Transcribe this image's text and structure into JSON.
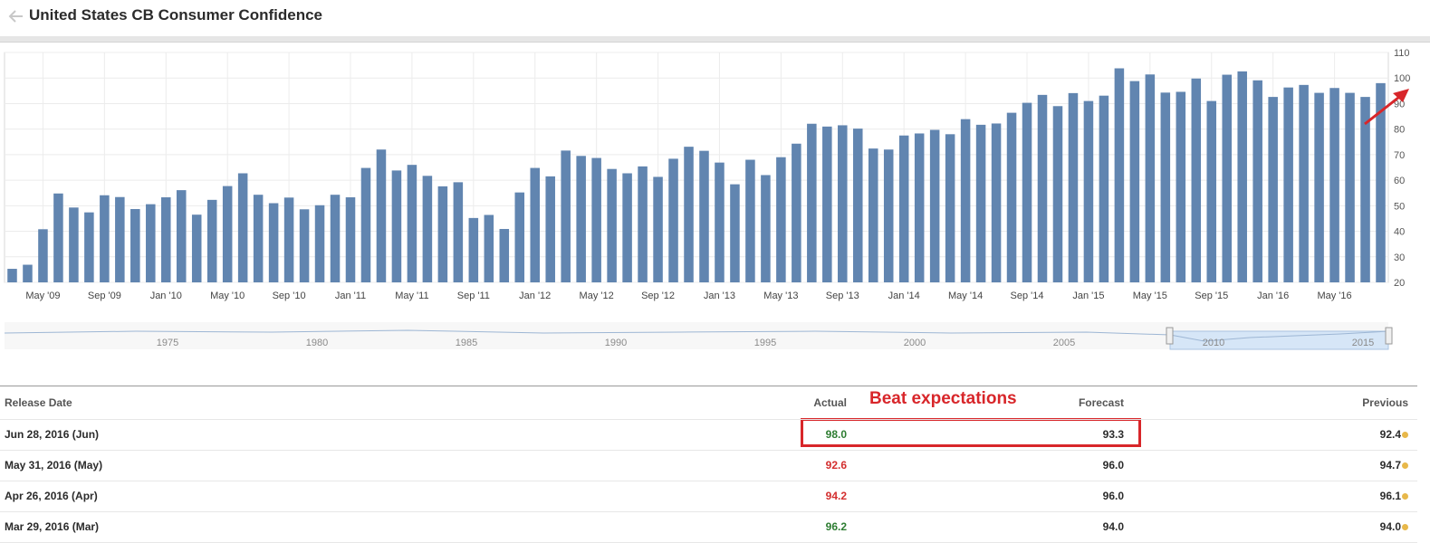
{
  "header": {
    "title": "United States CB Consumer Confidence"
  },
  "colors": {
    "bar": "#6185b0",
    "actual_up": "#2e7d32",
    "actual_down": "#d32f2f",
    "annotation": "#d8262a",
    "dot": "#e8b84a"
  },
  "chart_data": {
    "type": "bar",
    "title": "",
    "xlabel": "",
    "ylabel": "",
    "ylim": [
      20,
      110
    ],
    "yticks": [
      20,
      30,
      40,
      50,
      60,
      70,
      80,
      90,
      100,
      110
    ],
    "x_tick_labels": [
      "May '09",
      "Sep '09",
      "Jan '10",
      "May '10",
      "Sep '10",
      "Jan '11",
      "May '11",
      "Sep '11",
      "Jan '12",
      "May '12",
      "Sep '12",
      "Jan '13",
      "May '13",
      "Sep '13",
      "Jan '14",
      "May '14",
      "Sep '14",
      "Jan '15",
      "May '15",
      "Sep '15",
      "Jan '16",
      "May '16"
    ],
    "x_tick_index": [
      2,
      6,
      10,
      14,
      18,
      22,
      26,
      30,
      34,
      38,
      42,
      46,
      50,
      54,
      58,
      62,
      66,
      70,
      74,
      78,
      82,
      86
    ],
    "values": [
      25.3,
      26.9,
      40.8,
      54.8,
      49.3,
      47.4,
      54.1,
      53.4,
      48.7,
      50.6,
      53.3,
      56.1,
      46.5,
      52.3,
      57.7,
      62.7,
      54.3,
      51.0,
      53.2,
      48.6,
      50.2,
      54.3,
      53.3,
      64.8,
      72.0,
      63.8,
      66.0,
      61.7,
      57.6,
      59.2,
      45.2,
      46.4,
      40.9,
      55.2,
      64.8,
      61.5,
      71.6,
      69.5,
      68.7,
      64.4,
      62.7,
      65.4,
      61.3,
      68.4,
      73.1,
      71.5,
      66.9,
      58.4,
      68.0,
      62.0,
      69.0,
      74.3,
      82.1,
      81.0,
      81.5,
      80.2,
      72.4,
      72.0,
      77.5,
      78.3,
      79.7,
      78.0,
      83.9,
      81.7,
      82.2,
      86.4,
      90.3,
      93.4,
      89.0,
      94.1,
      91.0,
      93.1,
      103.8,
      98.8,
      101.4,
      94.3,
      94.6,
      99.8,
      91.0,
      101.3,
      102.6,
      99.1,
      92.6,
      96.3,
      97.3,
      94.2,
      96.1,
      94.2,
      92.6,
      98.0
    ],
    "navigator": {
      "year_labels": [
        "1975",
        "1980",
        "1985",
        "1990",
        "1995",
        "2000",
        "2005",
        "2010",
        "2015"
      ]
    }
  },
  "annotation": {
    "text": "Beat expectations"
  },
  "table": {
    "headers": {
      "date": "Release Date",
      "actual": "Actual",
      "forecast": "Forecast",
      "previous": "Previous"
    },
    "rows": [
      {
        "date": "Jun 28, 2016 (Jun)",
        "actual": "98.0",
        "actual_trend": "up",
        "forecast": "93.3",
        "previous": "92.4"
      },
      {
        "date": "May 31, 2016 (May)",
        "actual": "92.6",
        "actual_trend": "down",
        "forecast": "96.0",
        "previous": "94.7"
      },
      {
        "date": "Apr 26, 2016 (Apr)",
        "actual": "94.2",
        "actual_trend": "down",
        "forecast": "96.0",
        "previous": "96.1"
      },
      {
        "date": "Mar 29, 2016 (Mar)",
        "actual": "96.2",
        "actual_trend": "up",
        "forecast": "94.0",
        "previous": "94.0"
      }
    ]
  }
}
